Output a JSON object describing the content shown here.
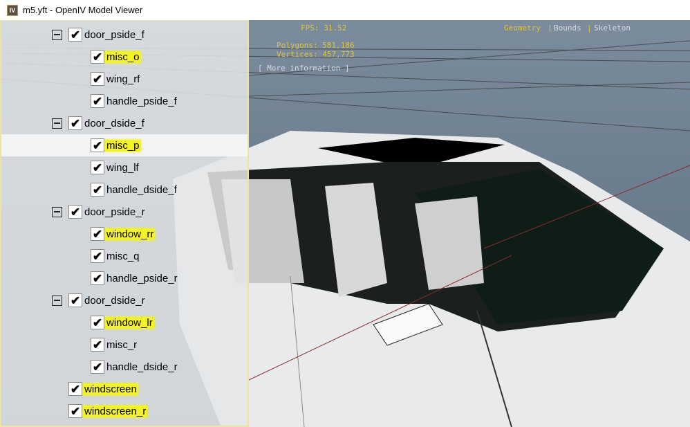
{
  "window": {
    "title": "m5.yft - OpenIV Model Viewer",
    "icon": "IV"
  },
  "hud": {
    "fps": "FPS: 31.52",
    "polygons": "Polygons: 581,186",
    "vertices": "Vertices: 457,773",
    "more_info": "[ More information ]",
    "modes": [
      "Geometry",
      "Bounds",
      "Skeleton"
    ],
    "active_mode": "Geometry",
    "separator": "|"
  },
  "tree": [
    {
      "label": "door_pside_f",
      "level": 1,
      "expander": true,
      "checked": true,
      "highlight": false
    },
    {
      "label": "misc_o",
      "level": 2,
      "checked": true,
      "highlight": true
    },
    {
      "label": "wing_rf",
      "level": 2,
      "checked": true,
      "highlight": false
    },
    {
      "label": "handle_pside_f",
      "level": 2,
      "checked": true,
      "highlight": false
    },
    {
      "label": "door_dside_f",
      "level": 1,
      "expander": true,
      "checked": true,
      "highlight": false
    },
    {
      "label": "misc_p",
      "level": 2,
      "checked": true,
      "highlight": true,
      "selected": true
    },
    {
      "label": "wing_lf",
      "level": 2,
      "checked": true,
      "highlight": false
    },
    {
      "label": "handle_dside_f",
      "level": 2,
      "checked": true,
      "highlight": false
    },
    {
      "label": "door_pside_r",
      "level": 1,
      "expander": true,
      "checked": true,
      "highlight": false
    },
    {
      "label": "window_rr",
      "level": 2,
      "checked": true,
      "highlight": true
    },
    {
      "label": "misc_q",
      "level": 2,
      "checked": true,
      "highlight": false
    },
    {
      "label": "handle_pside_r",
      "level": 2,
      "checked": true,
      "highlight": false
    },
    {
      "label": "door_dside_r",
      "level": 1,
      "expander": true,
      "checked": true,
      "highlight": false
    },
    {
      "label": "window_lr",
      "level": 2,
      "checked": true,
      "highlight": true
    },
    {
      "label": "misc_r",
      "level": 2,
      "checked": true,
      "highlight": false
    },
    {
      "label": "handle_dside_r",
      "level": 2,
      "checked": true,
      "highlight": false
    },
    {
      "label": "windscreen",
      "level": 1,
      "expander": false,
      "checked": true,
      "highlight": true
    },
    {
      "label": "windscreen_r",
      "level": 1,
      "expander": false,
      "checked": true,
      "highlight": true
    }
  ],
  "colors": {
    "hud_yellow": "#e0c43a",
    "highlight": "#f2f226"
  }
}
